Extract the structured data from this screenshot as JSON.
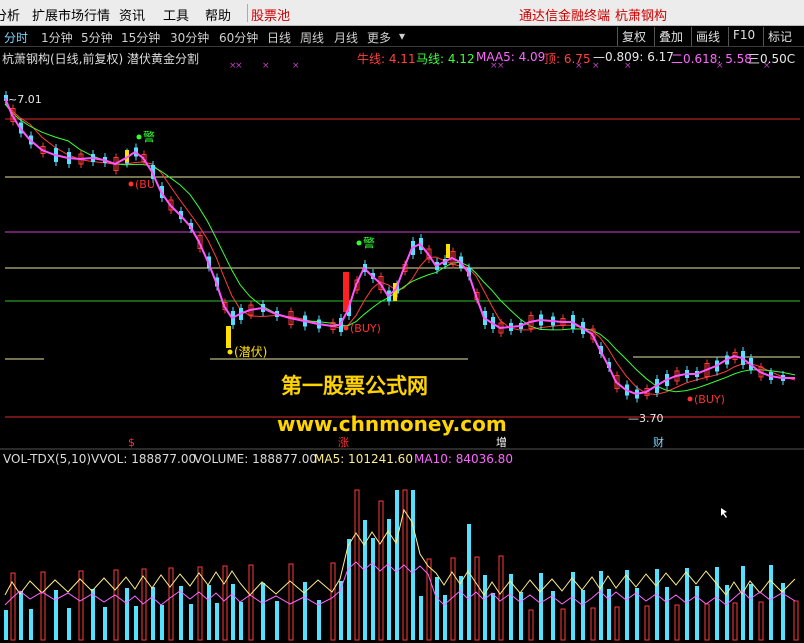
{
  "menu": {
    "items": [
      {
        "label": "分析",
        "red": false
      },
      {
        "label": "扩展市场行情",
        "red": false
      },
      {
        "label": "资讯",
        "red": false
      },
      {
        "label": "工具",
        "red": false
      },
      {
        "label": "帮助",
        "red": false
      },
      {
        "label": "股票池",
        "red": true
      }
    ],
    "app_title": "通达信金融终端",
    "stock_title": "杭萧钢构"
  },
  "periods": {
    "items": [
      "分时",
      "1分钟",
      "5分钟",
      "15分钟",
      "30分钟",
      "60分钟",
      "日线",
      "周线",
      "月线",
      "更多"
    ],
    "active": "分时"
  },
  "tools": [
    "复权",
    "叠加",
    "画线",
    "F10",
    "标记"
  ],
  "info": {
    "title": "杭萧钢构(日线,前复权) 潜伏黄金分割",
    "niu": "牛线: 4.11",
    "ma": "马线: 4.12",
    "maa5": "MAA5: 4.09",
    "ding": "顶: 6.75",
    "fib1": "—0.809: 6.17",
    "fib2": "二0.618: 5.58",
    "fib3": "三0.50C"
  },
  "chart": {
    "price_high_label": "7.01",
    "price_low_label": "3.70",
    "signals": {
      "warn": "警",
      "buy": "(BUY)",
      "buy_partial": "(BU",
      "hide": "(潜伏)"
    },
    "markers": [
      "$",
      "涨",
      "增",
      "财"
    ]
  },
  "volume_info": {
    "name": "VOL-TDX(5,10)",
    "vvol": "VVOL: 188877.00",
    "volume": "VOLUME: 188877.00",
    "ma5": "MA5: 101241.60",
    "ma10": "MA10: 84036.80"
  },
  "watermark": {
    "line1": "第一股票公式网",
    "line2": "www.chnmoney.com"
  },
  "colors": {
    "up": "#ff3b3b",
    "down": "#54e1ff",
    "niu_line": "#ff3b3b",
    "ma_line": "#39ff39",
    "maa5_line": "#ff55ff",
    "ding_line": "#ffcc00",
    "fib_line": "#e0e0e0",
    "watermark": "#ffd400"
  }
}
